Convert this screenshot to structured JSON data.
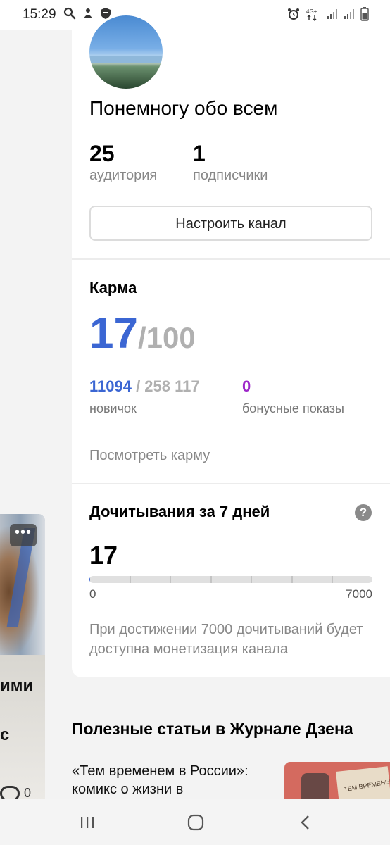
{
  "status_bar": {
    "time": "15:29",
    "left_icons": [
      "search-icon",
      "notification-icon",
      "shield-icon"
    ],
    "network_label": "4G+",
    "right_icons": [
      "alarm-icon",
      "network-icon",
      "signal-icon",
      "signal-icon",
      "battery-icon"
    ]
  },
  "peek_card": {
    "more_label": "•••",
    "text_line1": "ими",
    "text_line2": "с",
    "comment_count": "0"
  },
  "channel": {
    "name": "Понемногу обо всем",
    "audience_value": "25",
    "audience_label": "аудитория",
    "subscribers_value": "1",
    "subscribers_label": "подписчики",
    "setup_button": "Настроить канал"
  },
  "karma": {
    "title": "Карма",
    "value": "17",
    "max": "/100",
    "rank": "11094",
    "rank_total": " / 258 117",
    "rank_label": "новичок",
    "bonus_value": "0",
    "bonus_label": "бонусные показы",
    "view_link": "Посмотреть карму"
  },
  "reads": {
    "title": "Дочитывания за 7 дней",
    "help": "?",
    "value": "17",
    "progress_fraction": 0.0024,
    "scale_min": "0",
    "scale_max": "7000",
    "note": "При достижении 7000 дочитываний будет доступна монетизация канала"
  },
  "articles": {
    "title": "Полезные статьи в Журнале Дзена",
    "first_title": "«Тем временем в России»: комикс о жизни в",
    "thumb_text": "ТЕМ ВРЕМЕНЕМ"
  },
  "nav": {
    "icons": [
      "recents-icon",
      "home-icon",
      "back-icon"
    ]
  },
  "colors": {
    "accent_blue": "#3b66d3",
    "bonus_purple": "#9d26c9",
    "muted_gray": "#b0b0b0"
  }
}
